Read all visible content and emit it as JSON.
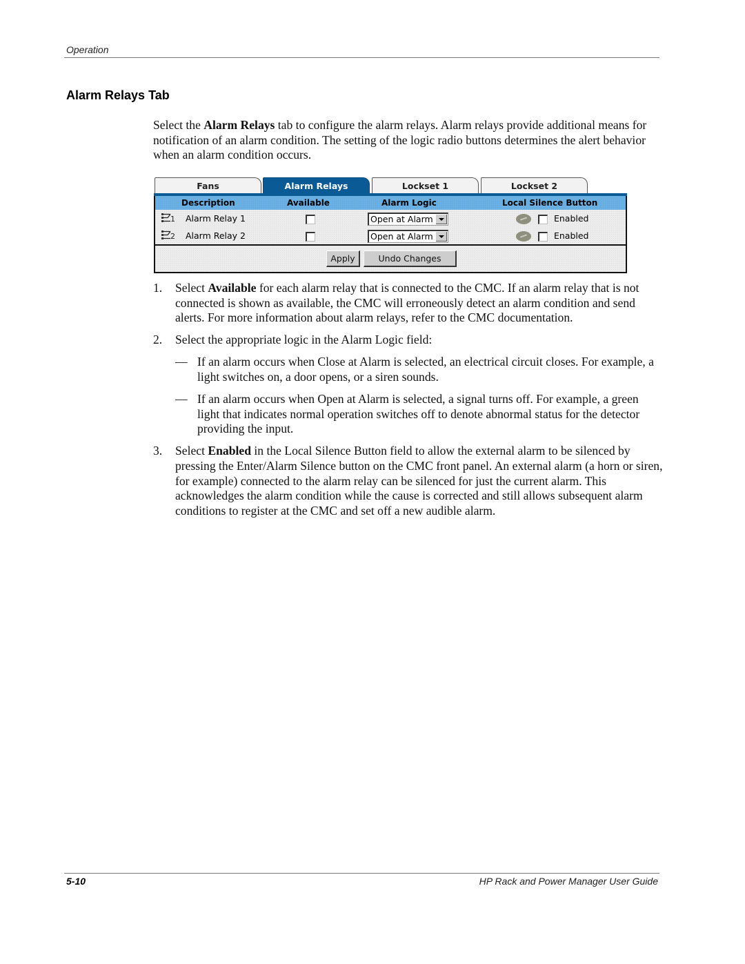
{
  "header": {
    "running_title": "Operation"
  },
  "section": {
    "title": "Alarm Relays Tab",
    "intro": {
      "prefix": "Select the ",
      "bold": "Alarm Relays",
      "suffix": " tab to configure the alarm relays. Alarm relays provide additional means for notification of an alarm condition. The setting of the logic radio buttons determines the alert behavior when an alarm condition occurs."
    }
  },
  "screenshot": {
    "tabs": [
      {
        "label": "Fans",
        "active": false
      },
      {
        "label": "Alarm Relays",
        "active": true
      },
      {
        "label": "Lockset 1",
        "active": false
      },
      {
        "label": "Lockset 2",
        "active": false
      }
    ],
    "columns": {
      "description": "Description",
      "available": "Available",
      "alarm_logic": "Alarm Logic",
      "local_silence": "Local Silence Button"
    },
    "rows": [
      {
        "icon": "relay-icon",
        "number": "1",
        "description": "Alarm Relay 1",
        "available": false,
        "alarm_logic": "Open at Alarm",
        "silence_icon": "silence-button-icon",
        "enabled": false,
        "enabled_label": "Enabled"
      },
      {
        "icon": "relay-icon",
        "number": "2",
        "description": "Alarm Relay 2",
        "available": false,
        "alarm_logic": "Open at Alarm",
        "silence_icon": "silence-button-icon",
        "enabled": false,
        "enabled_label": "Enabled"
      }
    ],
    "buttons": {
      "apply": "Apply",
      "undo": "Undo Changes"
    },
    "colors": {
      "tab_active": "#0a5a96",
      "header_row": "#6ab0e2",
      "panel_bg": "#ececec"
    }
  },
  "steps": [
    {
      "num": "1.",
      "prefix": "Select ",
      "bold": "Available",
      "suffix": " for each alarm relay that is connected to the CMC. If an alarm relay that is not connected is shown as available, the CMC will erroneously detect an alarm condition and send alerts. For more information about alarm relays, refer to the CMC documentation."
    },
    {
      "num": "2.",
      "prefix": "Select the appropriate logic in the Alarm Logic field:",
      "bold": "",
      "suffix": "",
      "sub": [
        {
          "dash": "—",
          "text": "If an alarm occurs when Close at Alarm is selected, an electrical circuit closes. For example, a light switches on, a door opens, or a siren sounds."
        },
        {
          "dash": "—",
          "text": "If an alarm occurs when Open at Alarm is selected, a signal turns off. For example, a green light that indicates normal operation switches off to denote abnormal status for the detector providing the input."
        }
      ]
    },
    {
      "num": "3.",
      "prefix": "Select ",
      "bold": "Enabled",
      "suffix": " in the Local Silence Button field to allow the external alarm to be silenced by pressing the Enter/Alarm Silence button on the CMC front panel. An external alarm (a horn or siren, for example) connected to the alarm relay can be silenced for just the current alarm. This acknowledges the alarm condition while the cause is corrected and still allows subsequent alarm conditions to register at the CMC and set off a new audible alarm."
    }
  ],
  "footer": {
    "page_number": "5-10",
    "doc_title": "HP Rack and Power Manager User Guide"
  }
}
